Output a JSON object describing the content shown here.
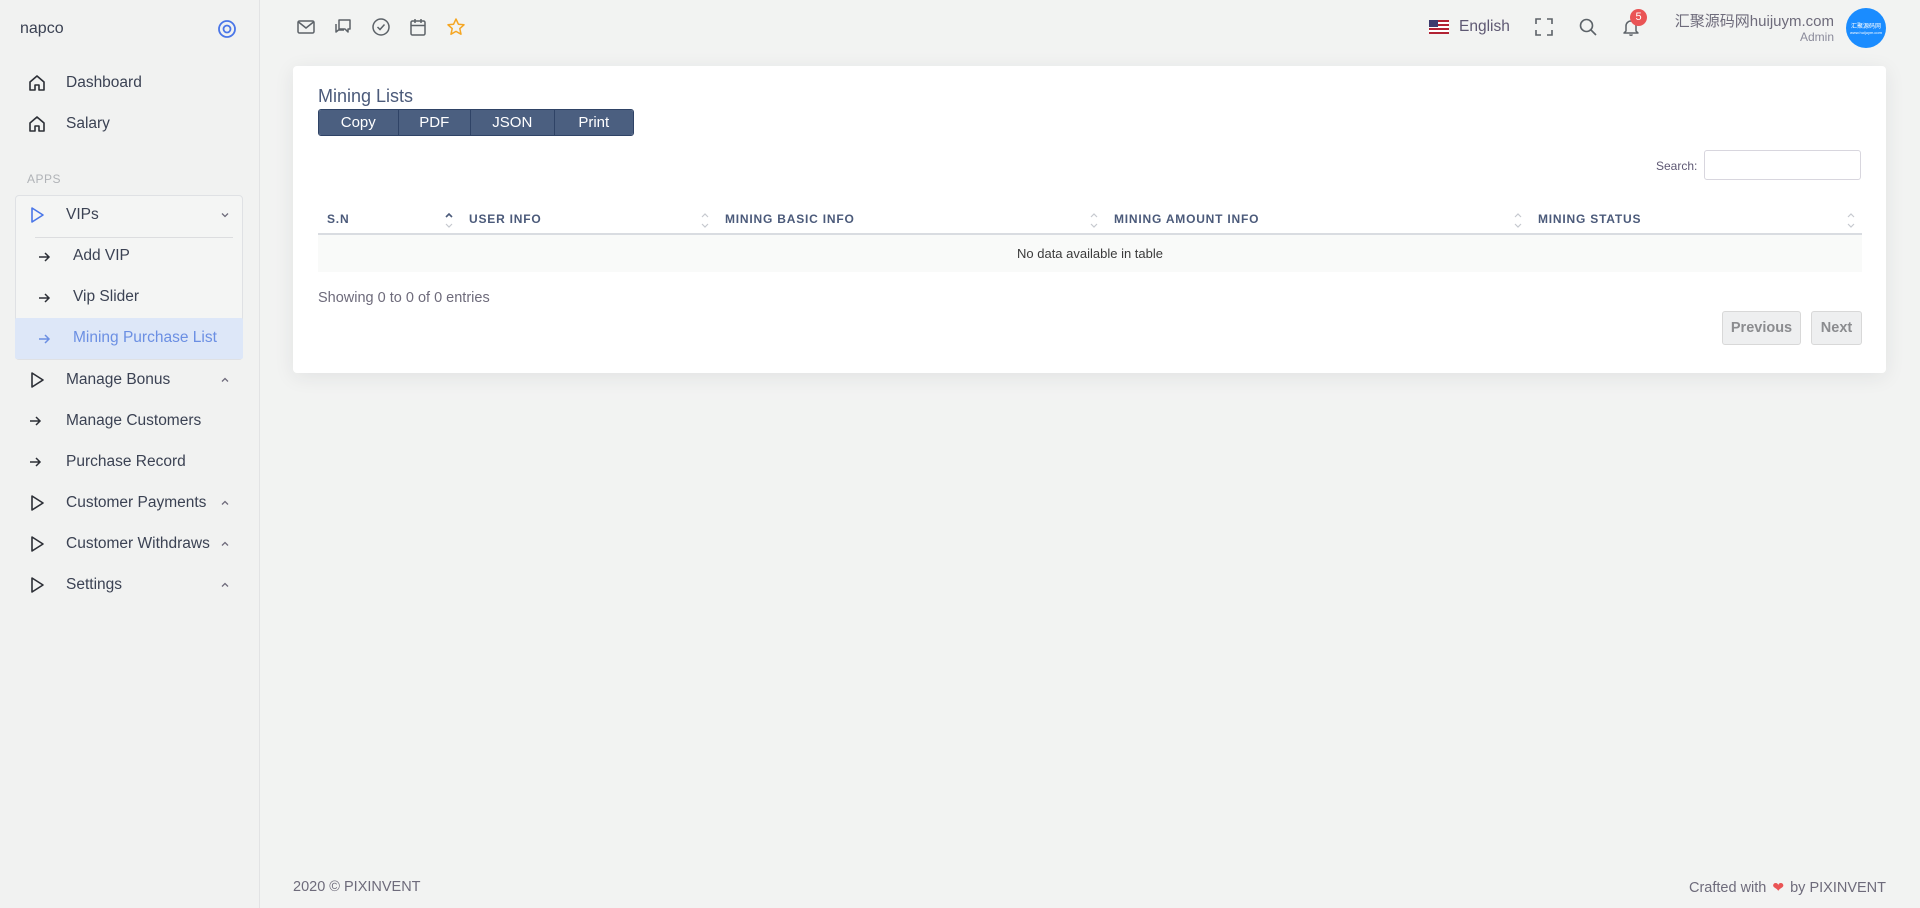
{
  "brand": {
    "name": "napco"
  },
  "sidebar": {
    "items": [
      {
        "label": "Dashboard"
      },
      {
        "label": "Salary"
      }
    ],
    "section_label": "APPS",
    "vips": {
      "label": "VIPs",
      "children": [
        {
          "label": "Add VIP"
        },
        {
          "label": "Vip Slider"
        },
        {
          "label": "Mining Purchase List",
          "active": true
        }
      ]
    },
    "more": [
      {
        "label": "Manage Bonus"
      },
      {
        "label": "Manage Customers"
      },
      {
        "label": "Purchase Record"
      },
      {
        "label": "Customer Payments"
      },
      {
        "label": "Customer Withdraws"
      },
      {
        "label": "Settings"
      }
    ]
  },
  "topbar": {
    "icons": [
      "mail-icon",
      "chat-icon",
      "check-circle-icon",
      "calendar-icon",
      "star-icon"
    ],
    "language": "English",
    "notification_count": "5",
    "user_name": "汇聚源码网huijuym.com",
    "user_role": "Admin",
    "avatar_text_1": "汇聚源码网",
    "avatar_text_2": "www.huijuym.com"
  },
  "card": {
    "title": "Mining Lists",
    "export_buttons": [
      "Copy",
      "PDF",
      "JSON",
      "Print"
    ],
    "search_label": "Search:",
    "search_value": "",
    "columns": [
      "S.N",
      "USER INFO",
      "MINING BASIC INFO",
      "MINING AMOUNT INFO",
      "MINING STATUS"
    ],
    "empty_text": "No data available in table",
    "info_text": "Showing 0 to 0 of 0 entries",
    "prev_label": "Previous",
    "next_label": "Next"
  },
  "footer": {
    "left": "2020 © PIXINVENT",
    "right_prefix": "Crafted with",
    "right_suffix": "by PIXINVENT"
  },
  "colors": {
    "accent": "#4a76e8",
    "button": "#4b5f80",
    "badge": "#ea5455",
    "star": "#f5a623"
  }
}
